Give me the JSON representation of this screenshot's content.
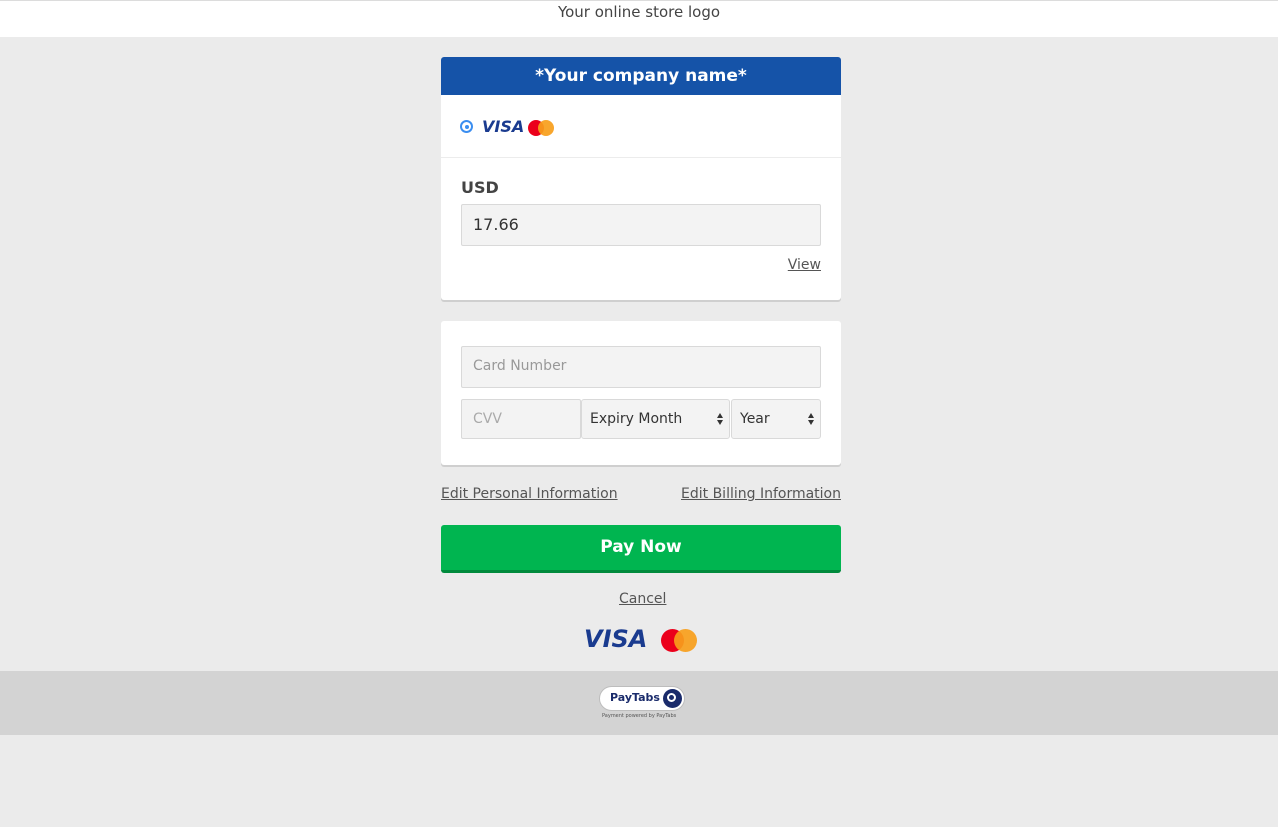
{
  "header": {
    "logo_text": "Your online store logo"
  },
  "merchant_card": {
    "company_name": "*Your company name*",
    "payment_methods": [
      "visa-icon",
      "mastercard-icon"
    ],
    "visa_text": "VISA",
    "currency": "USD",
    "amount": "17.66",
    "view_link": "View"
  },
  "card_form": {
    "card_number_placeholder": "Card Number",
    "cvv_placeholder": "CVV",
    "expiry_month_label": "Expiry Month",
    "year_label": "Year"
  },
  "links": {
    "edit_personal": "Edit Personal Information",
    "edit_billing": "Edit Billing Information",
    "cancel": "Cancel"
  },
  "pay_button": "Pay Now",
  "brand_logos": {
    "visa": "VISA"
  },
  "footer": {
    "paytabs_logo": "PayTabs",
    "powered_by": "Payment powered by PayTabs"
  },
  "colors": {
    "header_blue": "#1553a8",
    "pay_green": "#00b550",
    "page_bg": "#ebebeb",
    "footer_bg": "#d3d3d3"
  }
}
